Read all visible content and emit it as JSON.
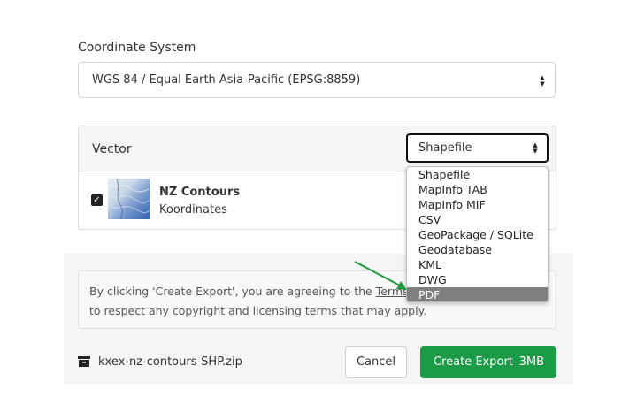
{
  "coordinate_system": {
    "label": "Coordinate System",
    "selected": "WGS 84 / Equal Earth Asia-Pacific (EPSG:8859)"
  },
  "vector": {
    "title": "Vector",
    "format_selected": "Shapefile",
    "layer": {
      "name": "NZ Contours",
      "subtitle": "Koordinates",
      "checked": true
    }
  },
  "format_dropdown": {
    "options": [
      "Shapefile",
      "MapInfo TAB",
      "MapInfo MIF",
      "CSV",
      "GeoPackage / SQLite",
      "Geodatabase",
      "KML",
      "DWG",
      "PDF"
    ],
    "highlighted": "PDF"
  },
  "terms": {
    "line1_prefix": "By clicking 'Create Export', you are agreeing to the",
    "link_text": "Terms of Us",
    "line2": "to respect any copyright and licensing terms that may apply."
  },
  "footer": {
    "file_name": "kxex-nz-contours-SHP.zip",
    "cancel_label": "Cancel",
    "export_label": "Create Export",
    "export_size": "3MB"
  },
  "colors": {
    "primary_green": "#1c9b47",
    "annotation_arrow": "#1f9a3c",
    "highlight_gray": "#7f7f7f"
  }
}
